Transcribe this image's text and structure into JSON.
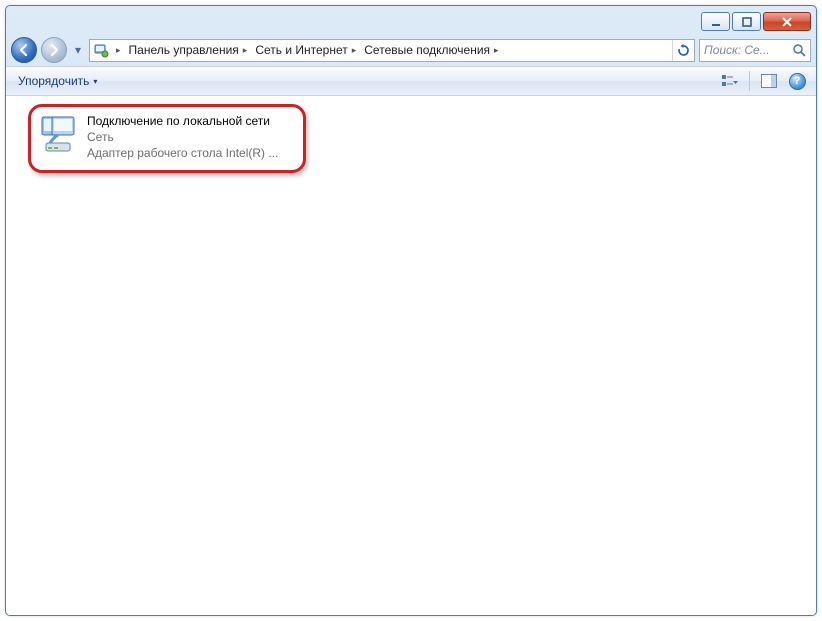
{
  "titlebar": {
    "min_glyph": "min",
    "max_glyph": "max",
    "close_glyph": "×"
  },
  "nav": {
    "history_glyph": "▾"
  },
  "breadcrumb": {
    "sep": "▸",
    "items": [
      {
        "label": "Панель управления"
      },
      {
        "label": "Сеть и Интернет"
      },
      {
        "label": "Сетевые подключения"
      }
    ]
  },
  "search": {
    "placeholder": "Поиск: Се..."
  },
  "toolbar": {
    "organize_label": "Упорядочить",
    "organize_drop": "▾",
    "help_glyph": "?"
  },
  "connection": {
    "title": "Подключение по локальной сети",
    "status": "Сеть",
    "device": "Адаптер рабочего стола Intel(R) ..."
  }
}
